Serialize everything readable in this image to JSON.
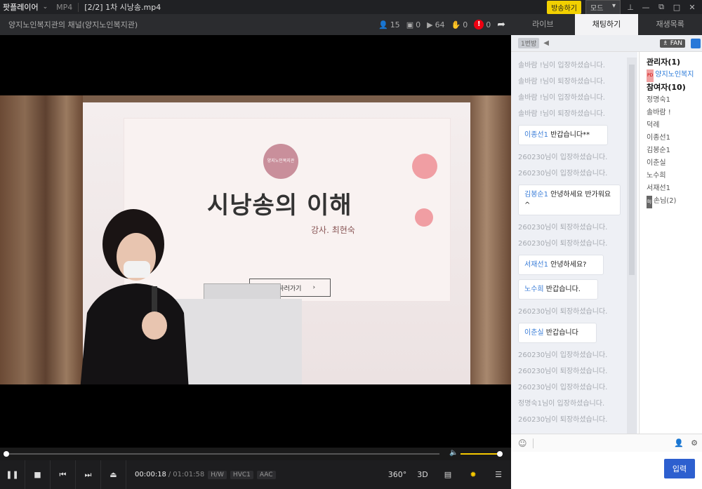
{
  "titlebar": {
    "app_name": "팟플레이어",
    "format": "MP4",
    "file": "[2/2] 1차 시낭송.mp4",
    "broadcast_btn": "방송하기",
    "mode_btn": "모드",
    "pin_icon": "pin-icon",
    "min_icon": "minimize-icon",
    "restore_icon": "restore-icon",
    "max_icon": "maximize-icon",
    "close_icon": "close-icon"
  },
  "channel": {
    "name": "양지노인복지관의 채널(양지노인복지관)",
    "viewers": "15",
    "gifts": "0",
    "plays": "64",
    "likes": "0",
    "alerts": "0",
    "alert_mark": "!"
  },
  "slide": {
    "title": "시낭송의 이해",
    "subtitle": "강사. 최현숙",
    "button": "교육 하러가기",
    "logo": "양지노인복지관"
  },
  "player": {
    "current_time": "00:00:18",
    "duration": "01:01:58",
    "tag_hw": "H/W",
    "tag_video": "HVC1",
    "tag_audio": "AAC",
    "btn_360": "360°",
    "btn_3d": "3D",
    "progress": 0.005,
    "volume": 1.0,
    "accent": "#f5c800"
  },
  "panel": {
    "tabs": [
      "라이브",
      "채팅하기",
      "재생목록"
    ],
    "active_tab": 1,
    "room": "1번방",
    "fan_btn": "FAN",
    "send_btn": "입력",
    "send_color": "#2d5fcf"
  },
  "chat": {
    "sys1": "솔바람 !님이 입장하셨습니다.",
    "sys2": "솔바람 !님이 퇴장하셨습니다.",
    "sys3": "솔바람 !님이 입장하셨습니다.",
    "sys4": "솔바람 !님이 퇴장하셨습니다.",
    "msg1_nick": "이종선1",
    "msg1_text": "반갑습니다**",
    "sys5": "260230님이 입장하셨습니다.",
    "sys6": "260230님이 입장하셨습니다.",
    "msg2_nick": "김봉순1",
    "msg2_text": "안녕하세요 반가워요 ^",
    "sys7": "260230님이 퇴장하셨습니다.",
    "sys8": "260230님이 퇴장하셨습니다.",
    "msg3_nick": "서재선1",
    "msg3_text": "안녕하세요?",
    "msg4_nick": "노수희",
    "msg4_text": "반갑습니다.",
    "sys9": "260230님이 퇴장하셨습니다.",
    "msg5_nick": "이춘실",
    "msg5_text": "반갑습니다",
    "sys10": "260230님이 입장하셨습니다.",
    "sys11": "260230님이 퇴장하셨습니다.",
    "sys12": "260230님이 입장하셨습니다.",
    "sys13": "정명숙1님이 입장하셨습니다.",
    "sys14": "260230님이 퇴장하셨습니다."
  },
  "users": {
    "admin_header": "관리자(1)",
    "admin_badge": "PD",
    "admin_name": "양지노인복지",
    "part_header": "참여자(10)",
    "u1": "정명숙1",
    "u2": "솔바람 !",
    "u3": "덕례",
    "u4": "이종선1",
    "u5": "김봉순1",
    "u6": "이춘실",
    "u7": "노수희",
    "u8": "서재선1",
    "guest_badge": "BJ",
    "guest": "손님(2)"
  }
}
